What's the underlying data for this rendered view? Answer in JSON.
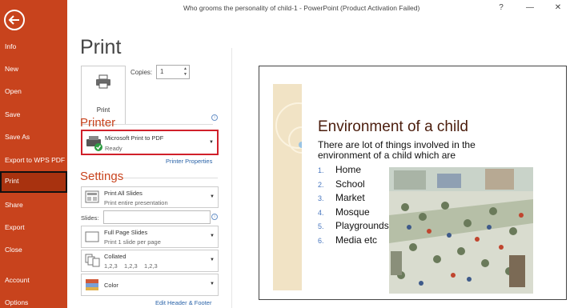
{
  "window": {
    "title": "Who grooms the personality of child-1 - PowerPoint (Product Activation Failed)",
    "help_label": "?",
    "minimize_label": "—",
    "close_label": "✕"
  },
  "sidebar": {
    "items": [
      {
        "label": "Info"
      },
      {
        "label": "New"
      },
      {
        "label": "Open"
      },
      {
        "label": "Save"
      },
      {
        "label": "Save As"
      },
      {
        "label": "Export to WPS PDF"
      },
      {
        "label": "Print",
        "active": true
      },
      {
        "label": "Share"
      },
      {
        "label": "Export"
      },
      {
        "label": "Close"
      },
      {
        "label": "Account"
      },
      {
        "label": "Options"
      }
    ]
  },
  "print_panel": {
    "heading": "Print",
    "print_button_label": "Print",
    "copies_label": "Copies:",
    "copies_value": "1",
    "printer_heading": "Printer",
    "printer_name": "Microsoft Print to PDF",
    "printer_status": "Ready",
    "printer_properties_link": "Printer Properties",
    "settings_heading": "Settings",
    "slides_range": {
      "title": "Print All Slides",
      "subtitle": "Print entire presentation"
    },
    "slides_label": "Slides:",
    "slides_value": "",
    "layout": {
      "title": "Full Page Slides",
      "subtitle": "Print 1 slide per page"
    },
    "collation": {
      "title": "Collated",
      "subtitle": "1,2,3    1,2,3    1,2,3"
    },
    "color": {
      "title": "Color"
    },
    "edit_header_footer_link": "Edit Header & Footer"
  },
  "preview": {
    "title": "Environment of a child",
    "subtitle": "There are lot of things involved in the environment of a child which are",
    "items": [
      {
        "num": "1.",
        "text": "Home"
      },
      {
        "num": "2.",
        "text": "School"
      },
      {
        "num": "3.",
        "text": "Market"
      },
      {
        "num": "4.",
        "text": "Mosque"
      },
      {
        "num": "5.",
        "text": "Playgrounds"
      },
      {
        "num": "6.",
        "text": "Media etc"
      }
    ]
  },
  "colors": {
    "accent": "#c8431d",
    "active_nav": "#a8320f",
    "link": "#2a63a8",
    "highlight_border": "#d0202a",
    "slide_title": "#4b1d0d"
  }
}
